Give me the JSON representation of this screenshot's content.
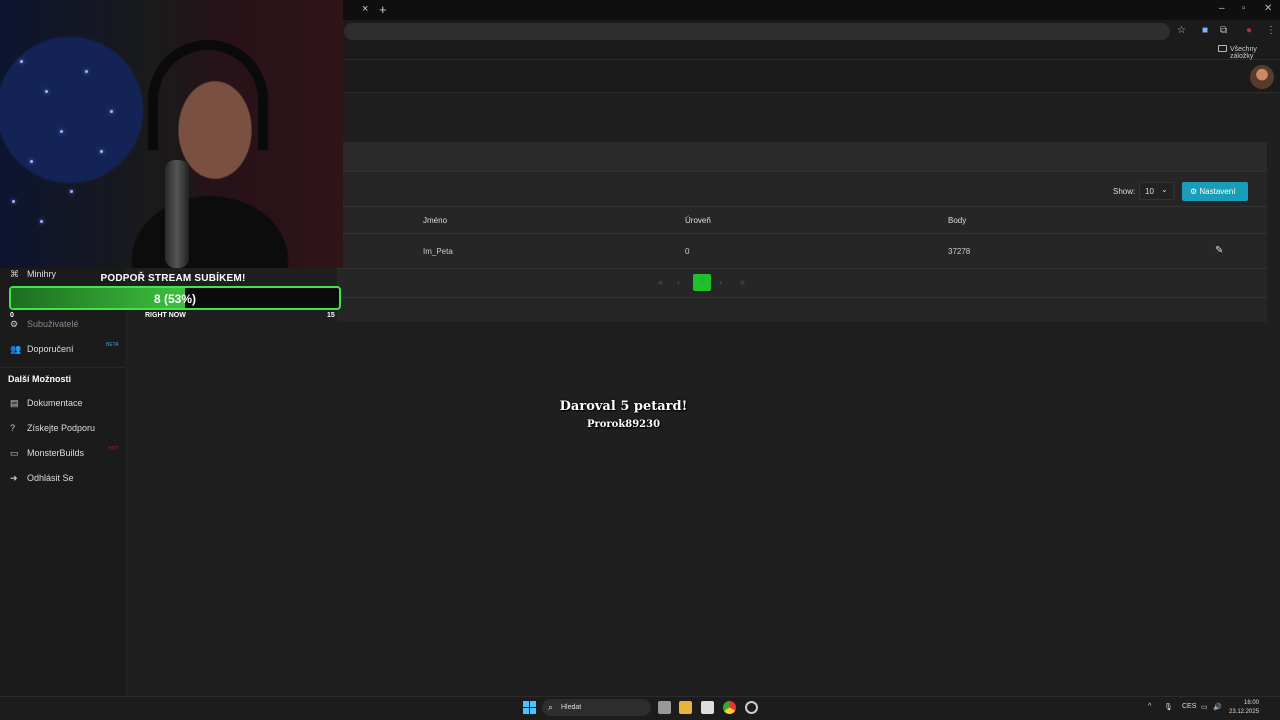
{
  "browser": {
    "close_tab": "×",
    "new_tab": "+",
    "bookmarks_label": "Všechny záložky"
  },
  "page": {
    "show_label": "Show:",
    "show_value": "10",
    "settings_button": "Nastavení",
    "columns": [
      "Jméno",
      "Úroveň",
      "Body"
    ],
    "rows": [
      {
        "name": "Im_Peta",
        "level": "0",
        "points": "37278"
      }
    ],
    "pagination": {
      "current": "1"
    }
  },
  "sidebar": {
    "items_top": [
      {
        "label": "Minihry",
        "icon": "gamepad-icon"
      },
      {
        "label": "Subuživatelé",
        "icon": "users-cog-icon"
      },
      {
        "label": "Doporučení",
        "icon": "users-icon",
        "badge": "BETA"
      }
    ],
    "section_label": "Další Možnosti",
    "items_bottom": [
      {
        "label": "Dokumentace",
        "icon": "book-icon"
      },
      {
        "label": "Získejte Podporu",
        "icon": "question-icon"
      },
      {
        "label": "MonsterBuilds",
        "icon": "laptop-icon",
        "badge": "HOT"
      },
      {
        "label": "Odhlásit Se",
        "icon": "logout-icon"
      }
    ]
  },
  "stream_goal": {
    "title": "PODPOŘ STREAM SUBÍKEM!",
    "value": "8 (53%)",
    "progress": 0.53,
    "start": "0",
    "label": "RIGHT NOW",
    "target": "15",
    "color": "#3ee64a"
  },
  "alert": {
    "line1": "Daroval 5 petard!",
    "line2": "Prorok89230"
  },
  "taskbar": {
    "search_placeholder": "Hledat",
    "language": "CES",
    "time": "16:00",
    "date": "23.12.2025"
  },
  "colors": {
    "accent": "#1a9db8",
    "active_page": "#1fbf2d",
    "background": "#1f1f1f"
  }
}
